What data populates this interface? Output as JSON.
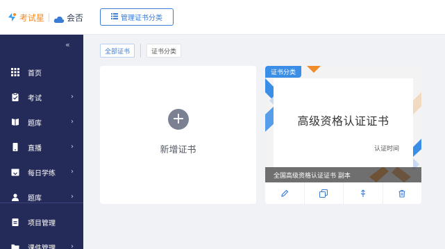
{
  "brand": {
    "name": "考试星",
    "sub": "会否"
  },
  "toolbar": {
    "category_button": "管理证书分类"
  },
  "sidebar": {
    "collapse_icon": "double-chevron-left-icon",
    "items": [
      {
        "label": "首页",
        "icon": "grid-icon",
        "has_arrow": false
      },
      {
        "label": "考试",
        "icon": "clipboard-icon",
        "has_arrow": true
      },
      {
        "label": "题库",
        "icon": "book-icon",
        "has_arrow": true
      },
      {
        "label": "直播",
        "icon": "phone-icon",
        "has_arrow": true
      },
      {
        "label": "每日学练",
        "icon": "calendar-icon",
        "has_arrow": true
      },
      {
        "label": "题库",
        "icon": "users-icon",
        "has_arrow": true
      },
      {
        "label": "项目管理",
        "icon": "clipboard-check-icon",
        "has_arrow": false
      },
      {
        "label": "课件管理",
        "icon": "folder-icon",
        "has_arrow": true
      }
    ]
  },
  "tabs": [
    {
      "label": "全部证书",
      "active": true
    },
    {
      "label": "证书分类",
      "active": false
    }
  ],
  "add_card": {
    "label": "新增证书"
  },
  "cert_card": {
    "badge": "证书分类",
    "title": "高级资格认证证书",
    "time_label": "认证时间",
    "caption": "全国高级资格认证证书  副本",
    "actions": [
      "edit-icon",
      "copy-icon",
      "share-icon",
      "delete-icon"
    ]
  },
  "colors": {
    "primary": "#3a7bd5",
    "sidebar": "#252b59",
    "accent": "#f08c2a"
  }
}
